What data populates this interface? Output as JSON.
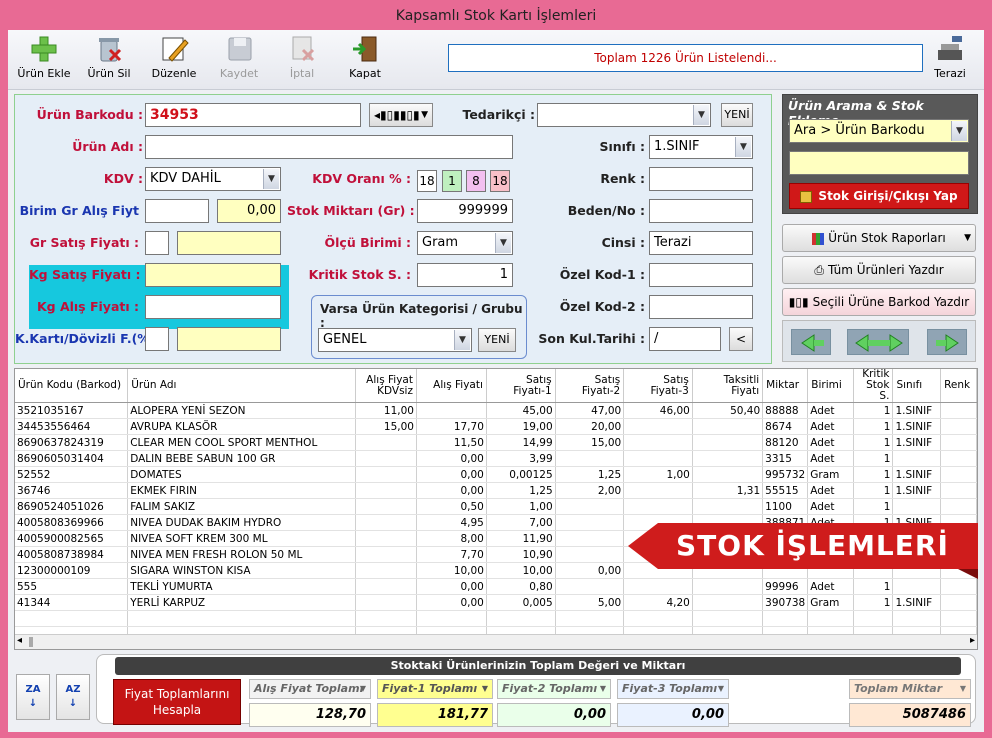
{
  "window": {
    "title": "Kapsamlı Stok Kartı İşlemleri"
  },
  "toolbar": {
    "add": "Ürün Ekle",
    "delete": "Ürün Sil",
    "edit": "Düzenle",
    "save": "Kaydet",
    "cancel": "İptal",
    "close": "Kapat",
    "scale": "Terazi",
    "status": "Toplam 1226 Ürün Listelendi..."
  },
  "form": {
    "barcode_label": "Ürün Barkodu :",
    "barcode_value": "34953",
    "supplier_label": "Tedarikçi :",
    "supplier_value": "",
    "new_label": "YENİ",
    "name_label": "Ürün Adı :",
    "name_value": "",
    "class_label": "Sınıfı :",
    "class_value": "1.SINIF",
    "kdv_label": "KDV :",
    "kdv_value": "KDV DAHİL",
    "kdv_rate_label": "KDV Oranı % :",
    "kdv_rate_value": "18",
    "kdv_opts": [
      "1",
      "8",
      "18"
    ],
    "color_label": "Renk :",
    "color_value": "",
    "unit_buy_label": "Birim Gr Alış Fiyt",
    "unit_buy_a": "",
    "unit_buy_b": "0,00",
    "stock_qty_label": "Stok Miktarı (Gr) :",
    "stock_qty_value": "999999",
    "size_label": "Beden/No :",
    "size_value": "",
    "gr_sale_label": "Gr Satış Fiyatı :",
    "gr_sale_a": "",
    "gr_sale_b": "",
    "unit_label": "Ölçü Birimi :",
    "unit_value": "Gram",
    "type_label": "Cinsi :",
    "type_value": "Terazi",
    "kg_sale_label": "Kg Satış Fiyatı :",
    "kg_sale_value": "",
    "critical_label": "Kritik Stok S. :",
    "critical_value": "1",
    "code1_label": "Özel Kod-1 :",
    "code1_value": "",
    "kg_buy_label": "Kg Alış Fiyatı :",
    "kg_buy_value": "",
    "category_label": "Varsa Ürün Kategorisi / Grubu :",
    "category_value": "GENEL",
    "code2_label": "Özel Kod-2 :",
    "code2_value": "",
    "card_label": "K.Kartı/Dövizli F.(%)",
    "card_a": "",
    "card_b": "",
    "last_date_label": "Son Kul.Tarihi :",
    "last_date_value": "/",
    "last_date_btn": "<"
  },
  "search": {
    "title": "Ürün Arama & Stok Ekleme",
    "mode": "Ara > Ürün Barkodu",
    "query": "",
    "stock_btn": "Stok Girişi/Çıkışı Yap",
    "reports_btn": "Ürün Stok Raporları",
    "print_all_btn": "Tüm Ürünleri Yazdır",
    "barcode_btn": "Seçili Ürüne Barkod Yazdır"
  },
  "grid": {
    "columns": [
      "Ürün Kodu (Barkod)",
      "Ürün Adı",
      "Alış Fiyat KDVsiz",
      "Alış Fiyatı",
      "Satış Fiyatı-1",
      "Satış Fiyatı-2",
      "Satış Fiyatı-3",
      "Taksitli Fiyatı",
      "Miktar",
      "Birimi",
      "Kritik Stok S.",
      "Sınıfı",
      "Renk"
    ],
    "rows": [
      [
        "3521035167",
        "ALOPERA YENİ SEZON",
        "11,00",
        "",
        "45,00",
        "47,00",
        "46,00",
        "50,40",
        "88888",
        "Adet",
        "1",
        "1.SINIF",
        ""
      ],
      [
        "34453556464",
        "AVRUPA KLASÖR",
        "15,00",
        "17,70",
        "19,00",
        "20,00",
        "",
        "",
        "8674",
        "Adet",
        "1",
        "1.SINIF",
        ""
      ],
      [
        "8690637824319",
        "CLEAR MEN COOL SPORT MENTHOL",
        "",
        "11,50",
        "14,99",
        "15,00",
        "",
        "",
        "88120",
        "Adet",
        "1",
        "1.SINIF",
        ""
      ],
      [
        "8690605031404",
        "DALIN BEBE SABUN 100 GR",
        "",
        "0,00",
        "3,99",
        "",
        "",
        "",
        "3315",
        "Adet",
        "1",
        "",
        ""
      ],
      [
        "52552",
        "DOMATES",
        "",
        "0,00",
        "0,00125",
        "1,25",
        "1,00",
        "",
        "995732",
        "Gram",
        "1",
        "1.SINIF",
        ""
      ],
      [
        "36746",
        "EKMEK FIRIN",
        "",
        "0,00",
        "1,25",
        "2,00",
        "",
        "1,31",
        "55515",
        "Adet",
        "1",
        "1.SINIF",
        ""
      ],
      [
        "8690524051026",
        "FALIM SAKIZ",
        "",
        "0,50",
        "1,00",
        "",
        "",
        "",
        "1100",
        "Adet",
        "1",
        "",
        ""
      ],
      [
        "4005808369966",
        "NIVEA DUDAK BAKIM HYDRO",
        "",
        "4,95",
        "7,00",
        "",
        "",
        "",
        "388871",
        "Adet",
        "1",
        "1.SINIF",
        ""
      ],
      [
        "4005900082565",
        "NIVEA SOFT KREM 300 ML",
        "",
        "8,00",
        "11,90",
        "",
        "",
        "",
        "",
        "",
        "",
        "",
        ""
      ],
      [
        "4005808738984",
        "NIVEA MEN FRESH ROLON 50 ML",
        "",
        "7,70",
        "10,90",
        "",
        "",
        "",
        "",
        "",
        "",
        "",
        ""
      ],
      [
        "12300000109",
        "SIGARA WINSTON KISA",
        "",
        "10,00",
        "10,00",
        "0,00",
        "",
        "",
        "",
        "",
        "",
        "",
        ""
      ],
      [
        "555",
        "TEKLİ YUMURTA",
        "",
        "0,00",
        "0,80",
        "",
        "",
        "",
        "99996",
        "Adet",
        "1",
        "",
        ""
      ],
      [
        "41344",
        "YERLİ KARPUZ",
        "",
        "0,00",
        "0,005",
        "5,00",
        "4,20",
        "",
        "390738",
        "Gram",
        "1",
        "1.SINIF",
        ""
      ]
    ]
  },
  "banner": "STOK İŞLEMLERİ",
  "totals": {
    "title": "Stoktaki Ürünlerinizin Toplam Değeri ve Miktarı",
    "calc_btn": "Fiyat Toplamlarını Hesapla",
    "sort_az": "ZA",
    "sort_za": "AZ",
    "buy_label": "Alış Fiyat Toplamı",
    "buy_value": "128,70",
    "f1_label": "Fiyat-1 Toplamı",
    "f1_value": "181,77",
    "f2_label": "Fiyat-2 Toplamı",
    "f2_value": "0,00",
    "f3_label": "Fiyat-3 Toplamı",
    "f3_value": "0,00",
    "qty_label": "Toplam Miktar",
    "qty_value": "5087486"
  }
}
